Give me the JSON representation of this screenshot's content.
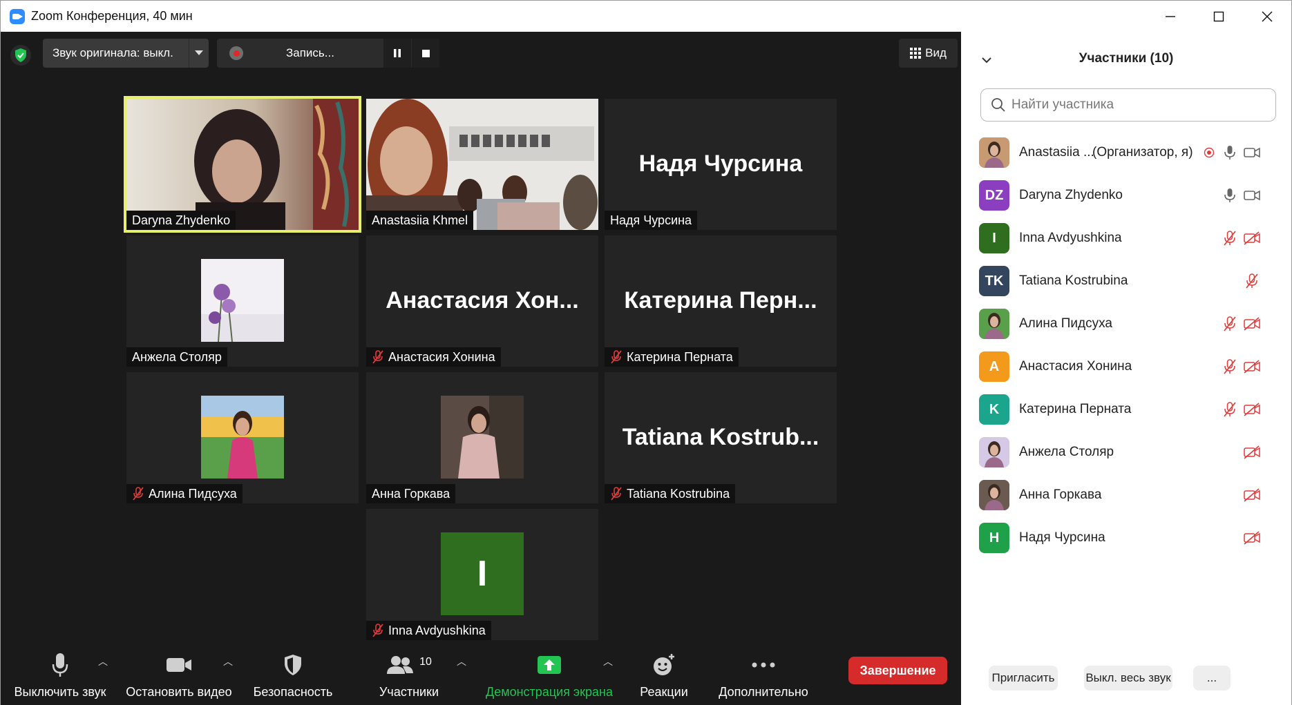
{
  "window": {
    "title": "Zoom Конференция, 40 мин",
    "minimize": "—",
    "maximize": "☐",
    "close": "✕"
  },
  "topbar": {
    "audio_label": "Звук оригинала: выкл.",
    "record_label": "Запись...",
    "view_label": "Вид"
  },
  "tiles": [
    {
      "name": "Daryna Zhydenko",
      "type": "video",
      "active": true,
      "muted": false
    },
    {
      "name": "Anastasiia Khmel",
      "type": "video",
      "active": false,
      "muted": false
    },
    {
      "name": "Надя Чурсина",
      "big": "Надя Чурсина",
      "type": "name",
      "muted": false
    },
    {
      "name": "Анжела Столяр",
      "type": "avatar",
      "muted": false
    },
    {
      "name": "Анастасия Хонина",
      "big": "Анастасия  Хон...",
      "type": "name",
      "muted": true
    },
    {
      "name": "Катерина Перната",
      "big": "Катерина  Перн...",
      "type": "name",
      "muted": true
    },
    {
      "name": "Алина Пидсуха",
      "type": "avatar",
      "muted": true
    },
    {
      "name": "Анна Горкава",
      "type": "avatar",
      "muted": false
    },
    {
      "name": "Tatiana Kostrubina",
      "big": "Tatiana  Kostrub...",
      "type": "name",
      "muted": true
    },
    {
      "name": "Inna Avdyushkina",
      "type": "letter",
      "letter": "I",
      "muted": true
    }
  ],
  "toolbar": {
    "mute": "Выключить звук",
    "video": "Остановить видео",
    "security": "Безопасность",
    "participants": "Участники",
    "participants_count": "10",
    "share": "Демонстрация экрана",
    "reactions": "Реакции",
    "more": "Дополнительно",
    "end": "Завершение"
  },
  "panel": {
    "title": "Участники (10)",
    "search_placeholder": "Найти участника",
    "participants": [
      {
        "name": "Anastasiia ...",
        "role": "(Организатор, я)",
        "initials": "",
        "color": "#c89a72",
        "mic": "on",
        "cam": "on",
        "rec": true
      },
      {
        "name": "Daryna Zhydenko",
        "role": "",
        "initials": "DZ",
        "color": "#8b3fc0",
        "mic": "on",
        "cam": "on"
      },
      {
        "name": "Inna Avdyushkina",
        "role": "",
        "initials": "I",
        "color": "#2f6e1f",
        "mic": "off",
        "cam": "off"
      },
      {
        "name": "Tatiana Kostrubina",
        "role": "",
        "initials": "TK",
        "color": "#34465e",
        "mic": "off",
        "cam": "none"
      },
      {
        "name": "Алина Пидсуха",
        "role": "",
        "initials": "",
        "color": "#5a9f4a",
        "mic": "off",
        "cam": "off"
      },
      {
        "name": "Анастасия Хонина",
        "role": "",
        "initials": "A",
        "color": "#f39a1d",
        "mic": "off",
        "cam": "off"
      },
      {
        "name": "Катерина Перната",
        "role": "",
        "initials": "K",
        "color": "#1aa58c",
        "mic": "off",
        "cam": "off"
      },
      {
        "name": "Анжела Столяр",
        "role": "",
        "initials": "",
        "color": "#d6c9e6",
        "mic": "none",
        "cam": "off"
      },
      {
        "name": "Анна Горкава",
        "role": "",
        "initials": "",
        "color": "#6b5a50",
        "mic": "none",
        "cam": "off"
      },
      {
        "name": "Надя Чурсина",
        "role": "",
        "initials": "H",
        "color": "#1fa14a",
        "mic": "none",
        "cam": "off"
      }
    ],
    "invite": "Пригласить",
    "mute_all": "Выкл. весь звук",
    "more": "..."
  },
  "colors": {
    "meeting_bg": "#1a1a1a",
    "tile_bg": "#242424",
    "active_border": "#e6f06c",
    "share_green": "#23c552",
    "end_red": "#d52b2b",
    "muted_red": "#e03c3c"
  }
}
